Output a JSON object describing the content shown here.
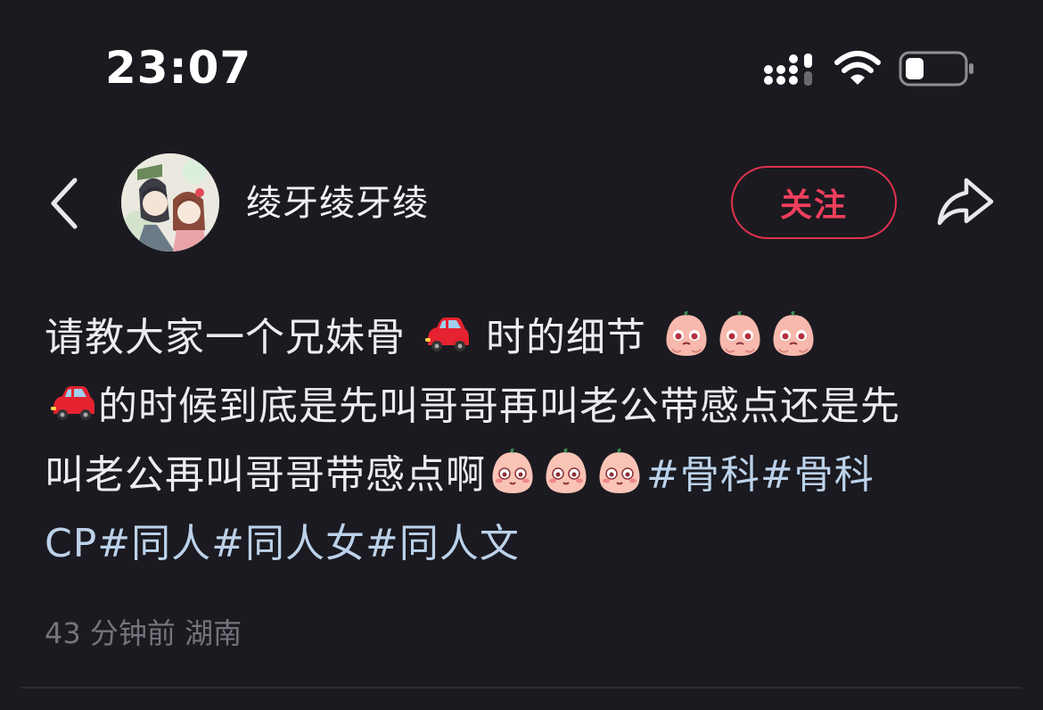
{
  "status_bar": {
    "time": "23:07"
  },
  "header": {
    "username": "绫牙绫牙绫",
    "follow_label": "关注"
  },
  "post": {
    "line1": "请教大家一个兄妹骨",
    "line1b": "时的细节",
    "line2": "的时候到底是先叫哥哥再叫老公带感点还是先",
    "line3": "叫老公再叫哥哥带感点啊",
    "tag1": "#骨科",
    "tag2a": "#骨科",
    "tag2b": "CP",
    "tag3": "#同人",
    "tag4": "#同人女",
    "tag5": "#同人文"
  },
  "meta": {
    "time_ago": "43 分钟前",
    "location": "湖南"
  },
  "icons": {
    "back": "chevron-left-icon",
    "share": "share-arrow-icon",
    "car": "red-car-emoji",
    "shy_face": "pink-blushing-face-emoji"
  },
  "colors": {
    "background": "#1b1a20",
    "accent": "#e0334f",
    "hashtag": "#bcd2ea",
    "meta": "#74747c"
  }
}
